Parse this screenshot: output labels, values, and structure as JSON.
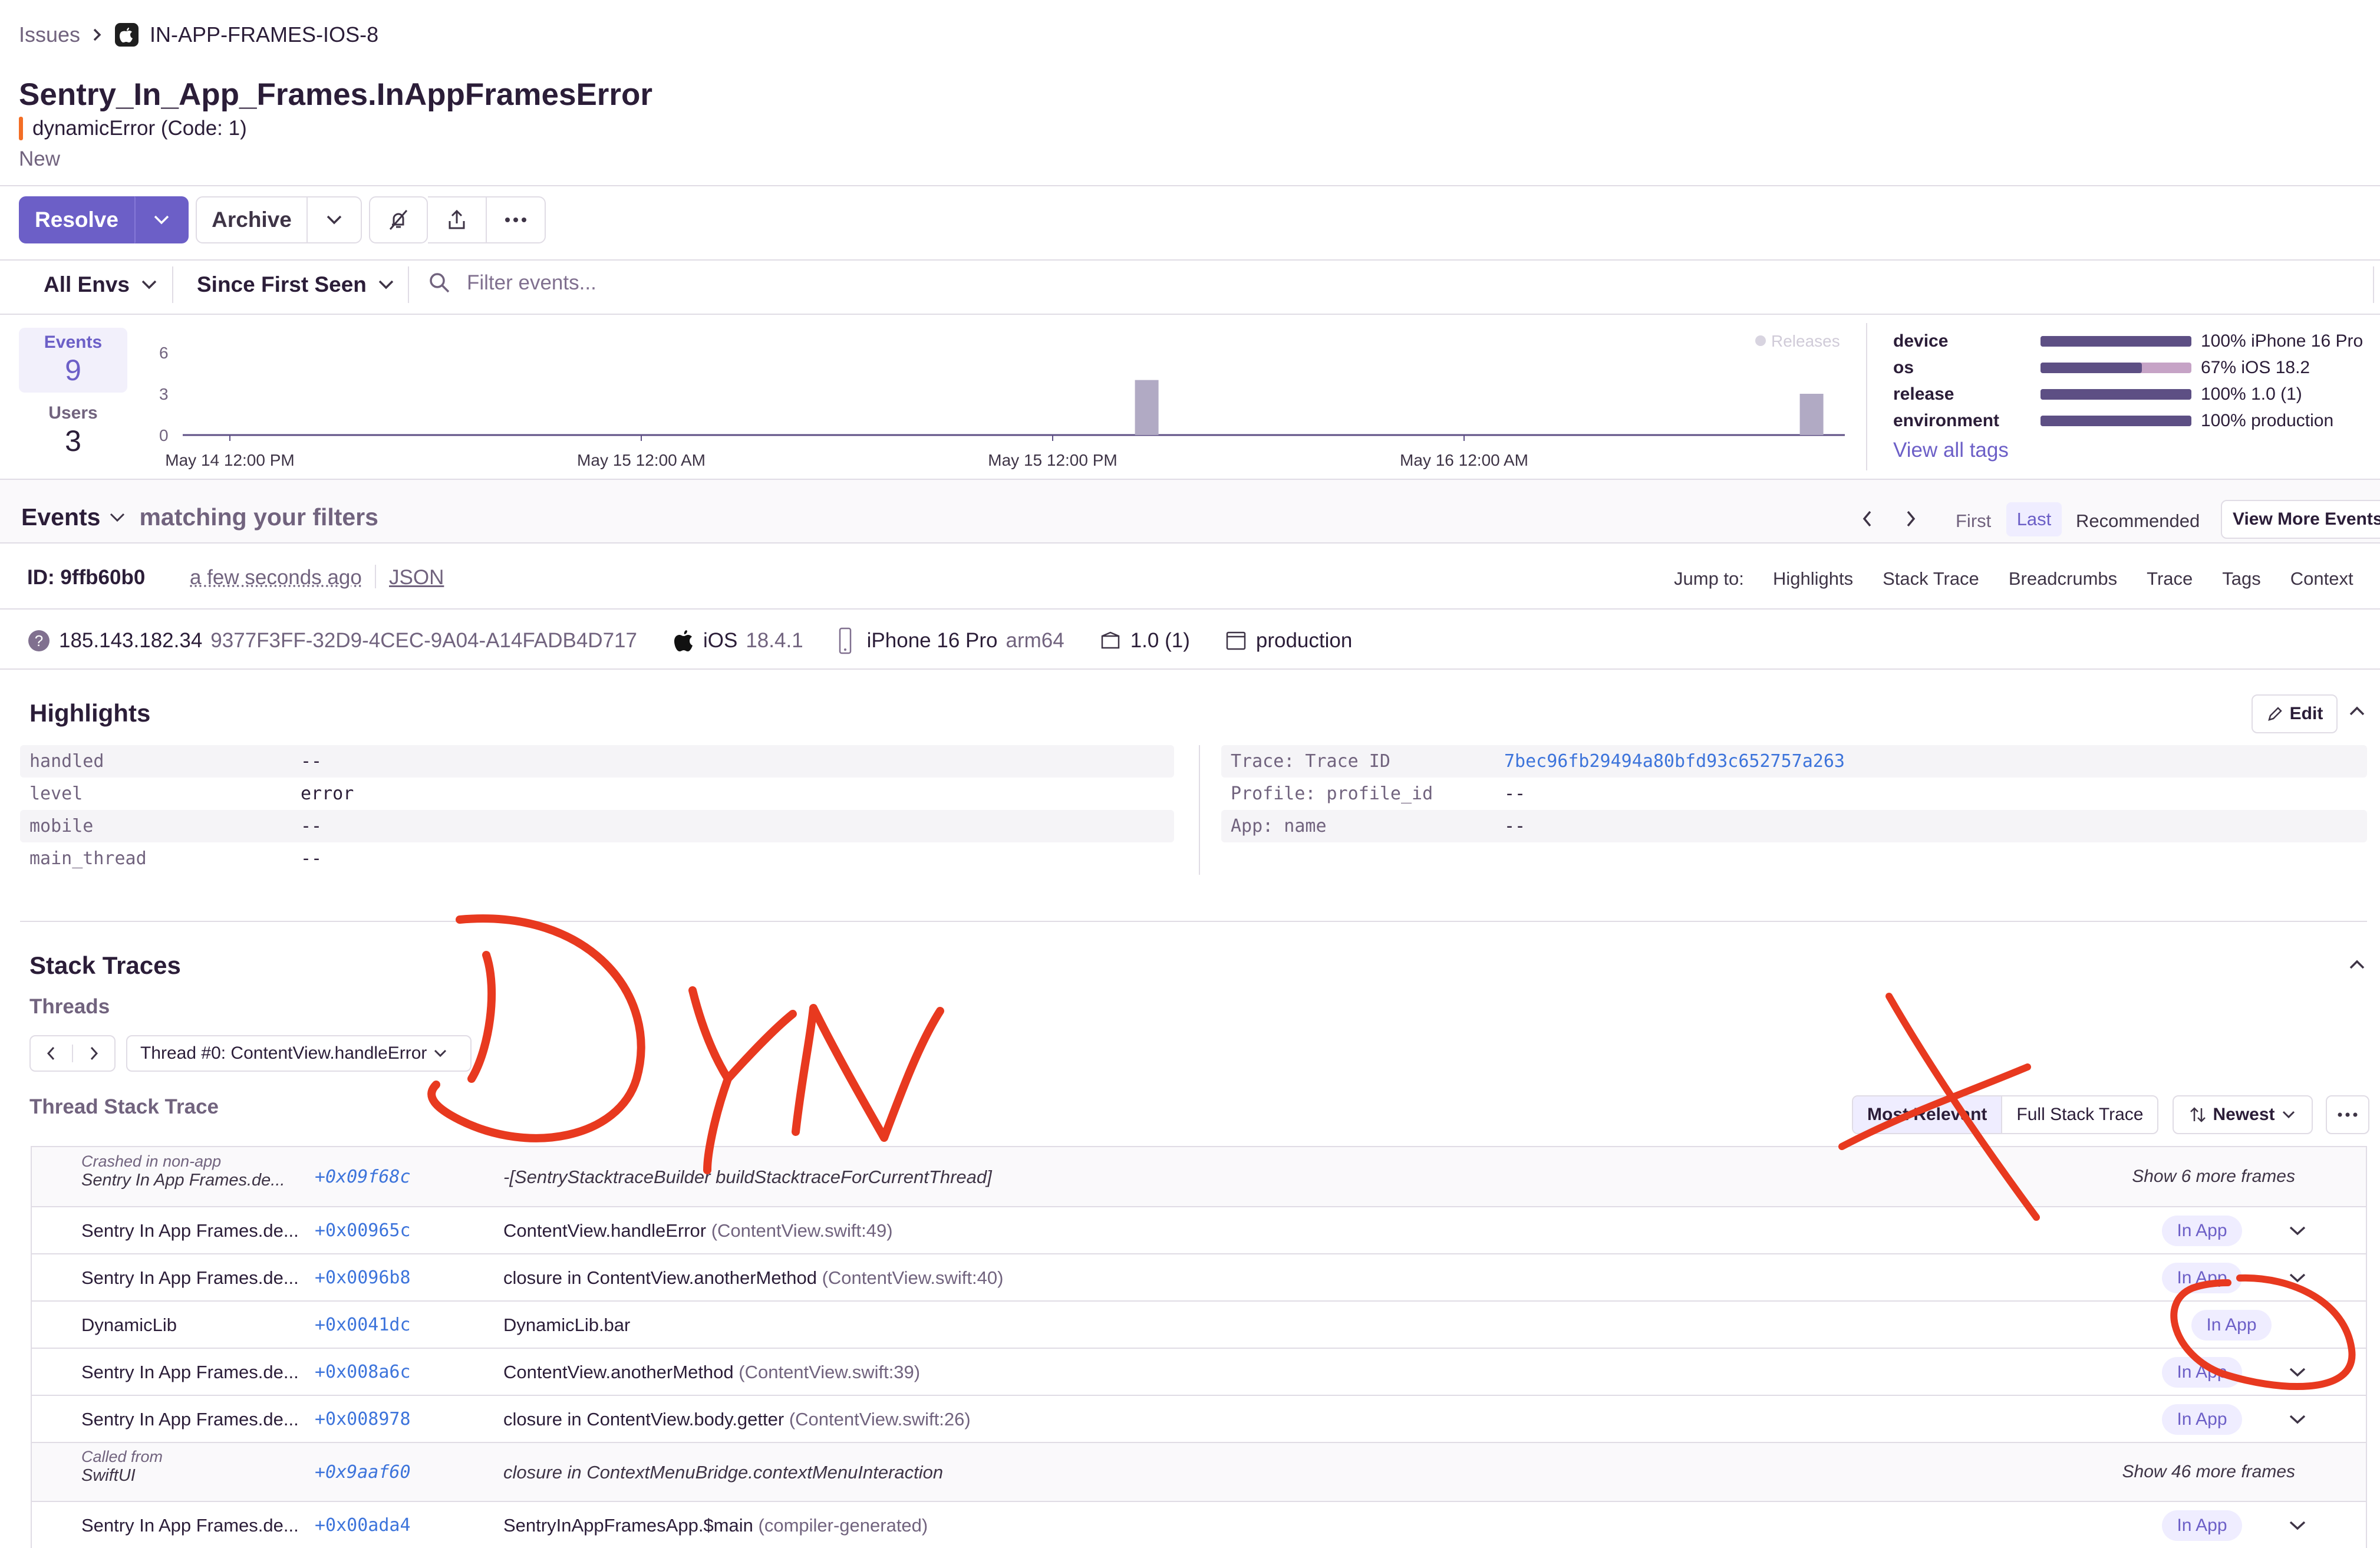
{
  "breadcrumb": {
    "root": "Issues",
    "current": "IN-APP-FRAMES-IOS-8"
  },
  "issue": {
    "title": "Sentry_In_App_Frames.InAppFramesError",
    "subtitle": "dynamicError (Code: 1)",
    "status": "New"
  },
  "toolbar": {
    "resolve": "Resolve",
    "archive": "Archive"
  },
  "filters": {
    "env": "All Envs",
    "time": "Since First Seen",
    "search_placeholder": "Filter events..."
  },
  "stats": {
    "events_label": "Events",
    "events": "9",
    "users_label": "Users",
    "users": "3",
    "releases_legend": "Releases"
  },
  "chart_data": {
    "type": "bar",
    "yticks": [
      "6",
      "3",
      "0"
    ],
    "ylim": [
      0,
      6
    ],
    "xticks": [
      "May 14 12:00 PM",
      "May 15 12:00 AM",
      "May 15 12:00 PM",
      "May 16 12:00 AM"
    ],
    "bars": [
      {
        "position": 0.58,
        "value": 4
      },
      {
        "position": 0.98,
        "value": 3
      }
    ],
    "color": "#b1aac4"
  },
  "tags": [
    {
      "name": "device",
      "pct": 100,
      "label": "100% iPhone 16 Pro"
    },
    {
      "name": "os",
      "pct": 67,
      "label": "67% iOS 18.2"
    },
    {
      "name": "release",
      "pct": 100,
      "label": "100% 1.0 (1)"
    },
    {
      "name": "environment",
      "pct": 100,
      "label": "100% production"
    }
  ],
  "view_all_tags": "View all tags",
  "events_bar": {
    "title": "Events",
    "subtitle": "matching your filters",
    "first": "First",
    "last": "Last",
    "recommended": "Recommended",
    "view_more": "View More Events"
  },
  "event": {
    "id": "ID: 9ffb60b0",
    "time": "a few seconds ago",
    "json": "JSON"
  },
  "jump": {
    "label": "Jump to:",
    "links": [
      "Highlights",
      "Stack Trace",
      "Breadcrumbs",
      "Trace",
      "Tags",
      "Context"
    ]
  },
  "context": {
    "ip": "185.143.182.34",
    "uuid": "9377F3FF-32D9-4CEC-9A04-A14FADB4D717",
    "os": "iOS",
    "os_version": "18.4.1",
    "device": "iPhone 16 Pro",
    "arch": "arm64",
    "release": "1.0 (1)",
    "env": "production"
  },
  "highlights": {
    "title": "Highlights",
    "edit": "Edit",
    "left": [
      [
        "handled",
        "--"
      ],
      [
        "level",
        "error"
      ],
      [
        "mobile",
        "--"
      ],
      [
        "main_thread",
        "--"
      ]
    ],
    "right": [
      [
        "Trace: Trace ID",
        "7bec96fb29494a80bfd93c652757a263"
      ],
      [
        "Profile: profile_id",
        "--"
      ],
      [
        "App: name",
        "--"
      ]
    ]
  },
  "stack": {
    "title": "Stack Traces",
    "threads": "Threads",
    "thread_select": "Thread #0: ContentView.handleError",
    "thread_trace": "Thread Stack Trace",
    "most_relevant": "Most Relevant",
    "full": "Full Stack Trace",
    "sort": "Newest",
    "frames": [
      {
        "module": "Crashed in non-app",
        "module2": "Sentry In App Frames.de...",
        "addr": "+0x09f68c",
        "fn": "-[SentryStacktraceBuilder buildStacktraceForCurrentThread]",
        "file": "",
        "right": "Show 6 more frames",
        "italic": true
      },
      {
        "module": "Sentry In App Frames.de...",
        "addr": "+0x00965c",
        "fn": "ContentView.handleError",
        "file": "(ContentView.swift:49)",
        "right": "In App"
      },
      {
        "module": "Sentry In App Frames.de...",
        "addr": "+0x0096b8",
        "fn": "closure in ContentView.anotherMethod",
        "file": "(ContentView.swift:40)",
        "right": "In App"
      },
      {
        "module": "DynamicLib",
        "addr": "+0x0041dc",
        "fn": "DynamicLib.bar",
        "file": "",
        "right": "In App"
      },
      {
        "module": "Sentry In App Frames.de...",
        "addr": "+0x008a6c",
        "fn": "ContentView.anotherMethod",
        "file": "(ContentView.swift:39)",
        "right": "In App"
      },
      {
        "module": "Sentry In App Frames.de...",
        "addr": "+0x008978",
        "fn": "closure in ContentView.body.getter",
        "file": "(ContentView.swift:26)",
        "right": "In App"
      },
      {
        "module": "Called from",
        "module2": "SwiftUI",
        "addr": "+0x9aaf60",
        "fn": "closure in ContextMenuBridge.contextMenuInteraction",
        "file": "",
        "right": "Show 46 more frames",
        "italic": true
      },
      {
        "module": "Sentry In App Frames.de...",
        "addr": "+0x00ada4",
        "fn": "SentryInAppFramesApp.$main",
        "file": "(compiler-generated)",
        "right": "In App"
      }
    ]
  },
  "annotation": {
    "text": "DYN"
  }
}
